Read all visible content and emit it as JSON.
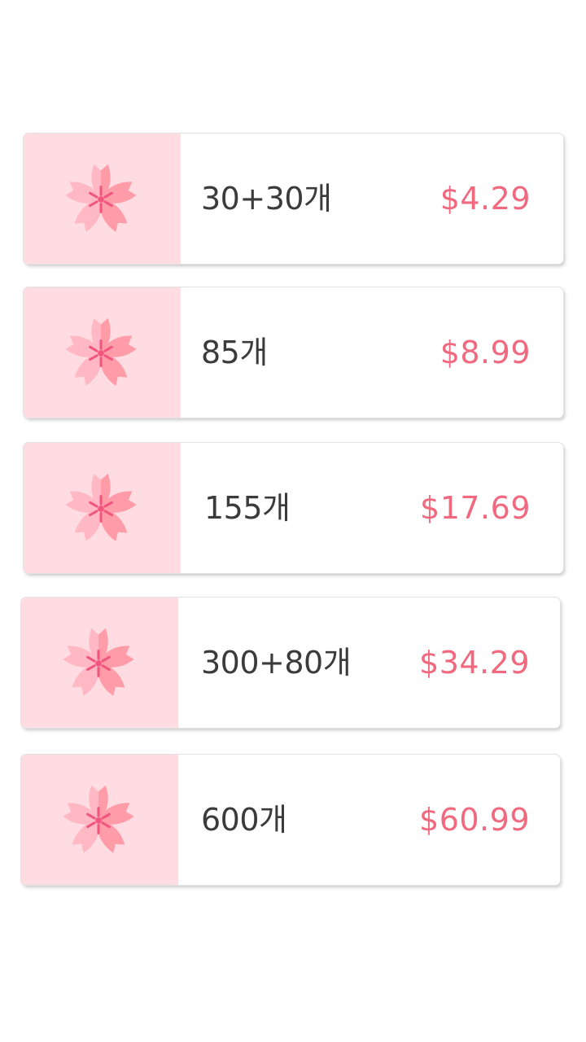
{
  "colors": {
    "thumb_bg": "#ffdbe2",
    "petal_light": "#ffb8c4",
    "petal_dark": "#ff9ca8",
    "stamen": "#f0567e",
    "price": "#f0697e",
    "text": "#3b3b3b"
  },
  "icon_name": "cherry-blossom-icon",
  "packages": [
    {
      "quantity": "30+30개",
      "price": "$4.29"
    },
    {
      "quantity": "85개",
      "price": "$8.99"
    },
    {
      "quantity": "155개",
      "price": "$17.69"
    },
    {
      "quantity": "300+80개",
      "price": "$34.29"
    },
    {
      "quantity": "600개",
      "price": "$60.99"
    }
  ]
}
